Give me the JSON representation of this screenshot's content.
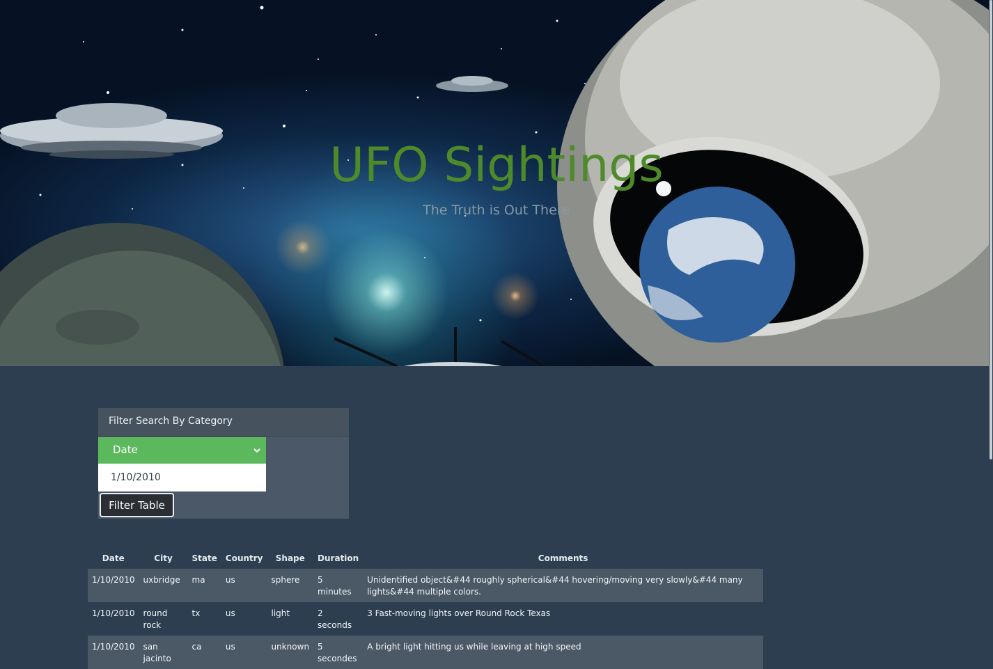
{
  "hero": {
    "title": "UFO Sightings",
    "subtitle": "The Truth is Out There"
  },
  "filter": {
    "heading": "Filter Search By Category",
    "category_selected": "Date",
    "input_value": "1/10/2010",
    "button_label": "Filter Table"
  },
  "table": {
    "headers": [
      "Date",
      "City",
      "State",
      "Country",
      "Shape",
      "Duration",
      "Comments"
    ],
    "rows": [
      [
        "1/10/2010",
        "uxbridge",
        "ma",
        "us",
        "sphere",
        "5 minutes",
        "Unidentified object&#44 roughly spherical&#44 hovering/moving very slowly&#44 many lights&#44 multiple colors."
      ],
      [
        "1/10/2010",
        "round rock",
        "tx",
        "us",
        "light",
        "2 seconds",
        "3 Fast-moving lights over Round Rock Texas"
      ],
      [
        "1/10/2010",
        "san jacinto",
        "ca",
        "us",
        "unknown",
        "5 secondes",
        "A bright light hitting us while leaving at high speed"
      ]
    ]
  },
  "colors": {
    "accent_green": "#5cb85c",
    "title_green": "#4e8a2a",
    "page_bg": "#2c3e50"
  }
}
